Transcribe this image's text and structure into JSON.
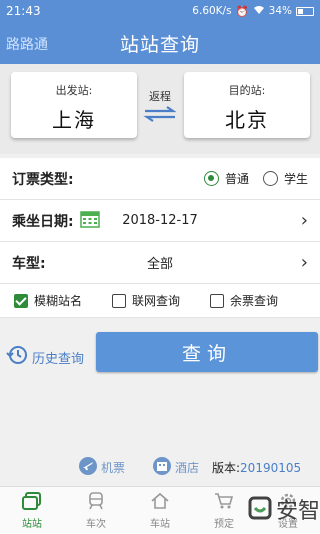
{
  "status_bar": {
    "time": "21:43",
    "network": "6.60K/s",
    "icons": [
      "alarm-icon",
      "wifi-icon"
    ],
    "battery": "34%"
  },
  "header": {
    "back_label": "路路通",
    "title": "站站查询"
  },
  "stations": {
    "from": {
      "label": "出发站:",
      "name": "上海"
    },
    "swap_label": "返程",
    "to": {
      "label": "目的站:",
      "name": "北京"
    }
  },
  "form": {
    "ticket_type": {
      "label": "订票类型:",
      "options": [
        "普通",
        "学生"
      ],
      "selected": "普通"
    },
    "date": {
      "label": "乘坐日期:",
      "value": "2018-12-17"
    },
    "train_type": {
      "label": "车型:",
      "value": "全部"
    },
    "options": [
      {
        "label": "模糊站名",
        "checked": true
      },
      {
        "label": "联网查询",
        "checked": false
      },
      {
        "label": "余票查询",
        "checked": false
      }
    ]
  },
  "actions": {
    "history_label": "历史查询",
    "query_label": "查询"
  },
  "footer_links": {
    "flight_label": "机票",
    "hotel_label": "酒店",
    "version_label": "版本:",
    "version_value": "20190105"
  },
  "bottom_nav": [
    {
      "label": "站站",
      "icon": "station-to-station-icon",
      "active": true
    },
    {
      "label": "车次",
      "icon": "train-icon",
      "active": false
    },
    {
      "label": "车站",
      "icon": "home-icon",
      "active": false
    },
    {
      "label": "预定",
      "icon": "cart-icon",
      "active": false
    },
    {
      "label": "设置",
      "icon": "settings-icon",
      "active": false
    }
  ],
  "watermark": "安智",
  "colors": {
    "primary": "#5a8fd6",
    "accent_green": "#2e8b3a",
    "link_blue": "#4a7fc8"
  }
}
